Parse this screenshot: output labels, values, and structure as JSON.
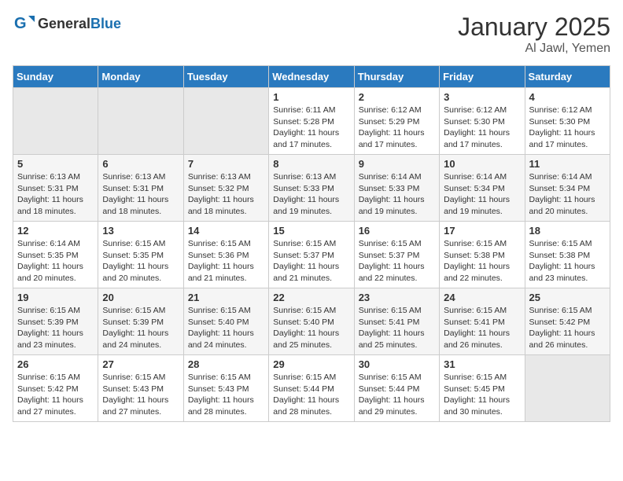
{
  "logo": {
    "text_general": "General",
    "text_blue": "Blue"
  },
  "title": {
    "month_year": "January 2025",
    "location": "Al Jawl, Yemen"
  },
  "weekdays": [
    "Sunday",
    "Monday",
    "Tuesday",
    "Wednesday",
    "Thursday",
    "Friday",
    "Saturday"
  ],
  "weeks": [
    [
      {
        "day": "",
        "sunrise": "",
        "sunset": "",
        "daylight": "",
        "empty": true
      },
      {
        "day": "",
        "sunrise": "",
        "sunset": "",
        "daylight": "",
        "empty": true
      },
      {
        "day": "",
        "sunrise": "",
        "sunset": "",
        "daylight": "",
        "empty": true
      },
      {
        "day": "1",
        "sunrise": "Sunrise: 6:11 AM",
        "sunset": "Sunset: 5:28 PM",
        "daylight": "Daylight: 11 hours and 17 minutes.",
        "empty": false
      },
      {
        "day": "2",
        "sunrise": "Sunrise: 6:12 AM",
        "sunset": "Sunset: 5:29 PM",
        "daylight": "Daylight: 11 hours and 17 minutes.",
        "empty": false
      },
      {
        "day": "3",
        "sunrise": "Sunrise: 6:12 AM",
        "sunset": "Sunset: 5:30 PM",
        "daylight": "Daylight: 11 hours and 17 minutes.",
        "empty": false
      },
      {
        "day": "4",
        "sunrise": "Sunrise: 6:12 AM",
        "sunset": "Sunset: 5:30 PM",
        "daylight": "Daylight: 11 hours and 17 minutes.",
        "empty": false
      }
    ],
    [
      {
        "day": "5",
        "sunrise": "Sunrise: 6:13 AM",
        "sunset": "Sunset: 5:31 PM",
        "daylight": "Daylight: 11 hours and 18 minutes.",
        "empty": false
      },
      {
        "day": "6",
        "sunrise": "Sunrise: 6:13 AM",
        "sunset": "Sunset: 5:31 PM",
        "daylight": "Daylight: 11 hours and 18 minutes.",
        "empty": false
      },
      {
        "day": "7",
        "sunrise": "Sunrise: 6:13 AM",
        "sunset": "Sunset: 5:32 PM",
        "daylight": "Daylight: 11 hours and 18 minutes.",
        "empty": false
      },
      {
        "day": "8",
        "sunrise": "Sunrise: 6:13 AM",
        "sunset": "Sunset: 5:33 PM",
        "daylight": "Daylight: 11 hours and 19 minutes.",
        "empty": false
      },
      {
        "day": "9",
        "sunrise": "Sunrise: 6:14 AM",
        "sunset": "Sunset: 5:33 PM",
        "daylight": "Daylight: 11 hours and 19 minutes.",
        "empty": false
      },
      {
        "day": "10",
        "sunrise": "Sunrise: 6:14 AM",
        "sunset": "Sunset: 5:34 PM",
        "daylight": "Daylight: 11 hours and 19 minutes.",
        "empty": false
      },
      {
        "day": "11",
        "sunrise": "Sunrise: 6:14 AM",
        "sunset": "Sunset: 5:34 PM",
        "daylight": "Daylight: 11 hours and 20 minutes.",
        "empty": false
      }
    ],
    [
      {
        "day": "12",
        "sunrise": "Sunrise: 6:14 AM",
        "sunset": "Sunset: 5:35 PM",
        "daylight": "Daylight: 11 hours and 20 minutes.",
        "empty": false
      },
      {
        "day": "13",
        "sunrise": "Sunrise: 6:15 AM",
        "sunset": "Sunset: 5:35 PM",
        "daylight": "Daylight: 11 hours and 20 minutes.",
        "empty": false
      },
      {
        "day": "14",
        "sunrise": "Sunrise: 6:15 AM",
        "sunset": "Sunset: 5:36 PM",
        "daylight": "Daylight: 11 hours and 21 minutes.",
        "empty": false
      },
      {
        "day": "15",
        "sunrise": "Sunrise: 6:15 AM",
        "sunset": "Sunset: 5:37 PM",
        "daylight": "Daylight: 11 hours and 21 minutes.",
        "empty": false
      },
      {
        "day": "16",
        "sunrise": "Sunrise: 6:15 AM",
        "sunset": "Sunset: 5:37 PM",
        "daylight": "Daylight: 11 hours and 22 minutes.",
        "empty": false
      },
      {
        "day": "17",
        "sunrise": "Sunrise: 6:15 AM",
        "sunset": "Sunset: 5:38 PM",
        "daylight": "Daylight: 11 hours and 22 minutes.",
        "empty": false
      },
      {
        "day": "18",
        "sunrise": "Sunrise: 6:15 AM",
        "sunset": "Sunset: 5:38 PM",
        "daylight": "Daylight: 11 hours and 23 minutes.",
        "empty": false
      }
    ],
    [
      {
        "day": "19",
        "sunrise": "Sunrise: 6:15 AM",
        "sunset": "Sunset: 5:39 PM",
        "daylight": "Daylight: 11 hours and 23 minutes.",
        "empty": false
      },
      {
        "day": "20",
        "sunrise": "Sunrise: 6:15 AM",
        "sunset": "Sunset: 5:39 PM",
        "daylight": "Daylight: 11 hours and 24 minutes.",
        "empty": false
      },
      {
        "day": "21",
        "sunrise": "Sunrise: 6:15 AM",
        "sunset": "Sunset: 5:40 PM",
        "daylight": "Daylight: 11 hours and 24 minutes.",
        "empty": false
      },
      {
        "day": "22",
        "sunrise": "Sunrise: 6:15 AM",
        "sunset": "Sunset: 5:40 PM",
        "daylight": "Daylight: 11 hours and 25 minutes.",
        "empty": false
      },
      {
        "day": "23",
        "sunrise": "Sunrise: 6:15 AM",
        "sunset": "Sunset: 5:41 PM",
        "daylight": "Daylight: 11 hours and 25 minutes.",
        "empty": false
      },
      {
        "day": "24",
        "sunrise": "Sunrise: 6:15 AM",
        "sunset": "Sunset: 5:41 PM",
        "daylight": "Daylight: 11 hours and 26 minutes.",
        "empty": false
      },
      {
        "day": "25",
        "sunrise": "Sunrise: 6:15 AM",
        "sunset": "Sunset: 5:42 PM",
        "daylight": "Daylight: 11 hours and 26 minutes.",
        "empty": false
      }
    ],
    [
      {
        "day": "26",
        "sunrise": "Sunrise: 6:15 AM",
        "sunset": "Sunset: 5:42 PM",
        "daylight": "Daylight: 11 hours and 27 minutes.",
        "empty": false
      },
      {
        "day": "27",
        "sunrise": "Sunrise: 6:15 AM",
        "sunset": "Sunset: 5:43 PM",
        "daylight": "Daylight: 11 hours and 27 minutes.",
        "empty": false
      },
      {
        "day": "28",
        "sunrise": "Sunrise: 6:15 AM",
        "sunset": "Sunset: 5:43 PM",
        "daylight": "Daylight: 11 hours and 28 minutes.",
        "empty": false
      },
      {
        "day": "29",
        "sunrise": "Sunrise: 6:15 AM",
        "sunset": "Sunset: 5:44 PM",
        "daylight": "Daylight: 11 hours and 28 minutes.",
        "empty": false
      },
      {
        "day": "30",
        "sunrise": "Sunrise: 6:15 AM",
        "sunset": "Sunset: 5:44 PM",
        "daylight": "Daylight: 11 hours and 29 minutes.",
        "empty": false
      },
      {
        "day": "31",
        "sunrise": "Sunrise: 6:15 AM",
        "sunset": "Sunset: 5:45 PM",
        "daylight": "Daylight: 11 hours and 30 minutes.",
        "empty": false
      },
      {
        "day": "",
        "sunrise": "",
        "sunset": "",
        "daylight": "",
        "empty": true
      }
    ]
  ]
}
